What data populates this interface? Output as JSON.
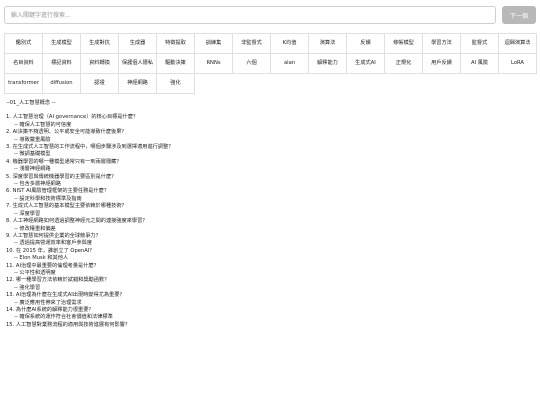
{
  "search": {
    "placeholder": "輸入關鍵字進行搜索...",
    "value": "",
    "next_label": "下一個"
  },
  "tags": [
    "鑑別式",
    "生成模型",
    "生成對抗",
    "生成器",
    "特徵提取",
    "訓練集",
    "非監督式",
    "K均值",
    "演算法",
    "反饋",
    "條帳模型",
    "學習方法",
    "監督式",
    "迴歸演算法",
    "名目資料",
    "標記資料",
    "資料轉換",
    "保護個人隱私",
    "驅動決策",
    "RNNs",
    "六個",
    "alan",
    "解釋能力",
    "生成式AI",
    "正規化",
    "用戶反饋",
    "AI 風險",
    "LoRA",
    "transformer",
    "diffusion",
    "認證",
    "神經網路",
    "強化"
  ],
  "section_title": "--01_人工智慧概念 --",
  "qa": [
    {
      "q": "1. 人工智慧治理（AI governance）的核心目標是什麼？",
      "a": "-- 確保人工智慧的可信度"
    },
    {
      "q": "2. AI決策不夠透明、公平或安全可能導致什麼後果？",
      "a": "-- 導致嚴重風險"
    },
    {
      "q": "3. 在生成式人工智慧的工作流程中，哪個步驟涉及到選擇適用進行調整？",
      "a": "-- 微調基礎模型"
    },
    {
      "q": "4. 機器學習的哪一種模型通常只有一到兩層隱藏？",
      "a": "-- 淺層神經網路"
    },
    {
      "q": "5. 深度學習與傳統機器學習的主要區別是什麼？",
      "a": "-- 包含多層神經網路"
    },
    {
      "q": "6. NIST AI風險管理框架的主要任務是什麼？",
      "a": "-- 設定科學和技術標準及指南"
    },
    {
      "q": "7. 生成式人工智慧的基本模型主要依賴於哪種技術？",
      "a": "-- 深度學習"
    },
    {
      "q": "8. 人工神經網路如何透過調整神經元之間的連接強度來學習？",
      "a": "-- 修改權重和偏差"
    },
    {
      "q": "9. 人工智慧如何提供企業的全球競爭力？",
      "a": "-- 透過提高營運效率和客戶參與度"
    },
    {
      "q": "10. 在 2015 年，誰創立了 OpenAI？",
      "a": "-- Elon Musk 和其他人"
    },
    {
      "q": "11. AI治理中最重要的倫理考量是什麼？",
      "a": "-- 公平性和透明度"
    },
    {
      "q": "12. 哪一種學習方法依賴於試錯和獎勵函數？",
      "a": "-- 強化學習"
    },
    {
      "q": "13. AI治理為什麼在生成式AI出現時變得尤為重要？",
      "a": "-- 廣泛應用性帶來了治理需求"
    },
    {
      "q": "14. 為什麼AI系統的解釋能力很重要？",
      "a": "-- 確保系統的運作符合社會價值和法律標準"
    },
    {
      "q": "15. 人工智慧對業務流程的適用與技術進展有何影響？",
      "a": ""
    }
  ]
}
